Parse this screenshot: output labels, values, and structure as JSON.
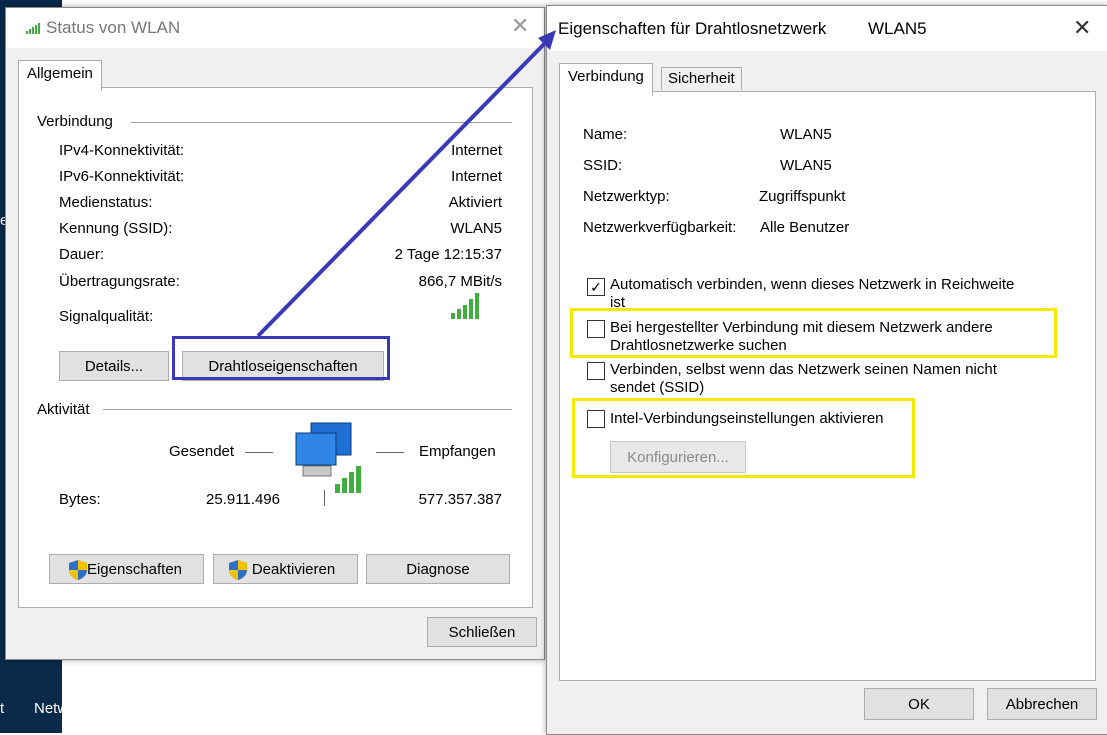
{
  "desktop": {
    "text1": "Netw",
    "text2": "e",
    "text3": "t"
  },
  "status_window": {
    "title": "Status von WLAN",
    "tab": "Allgemein",
    "connection_group": "Verbindung",
    "rows": [
      {
        "label": "IPv4-Konnektivität:",
        "value": "Internet"
      },
      {
        "label": "IPv6-Konnektivität:",
        "value": "Internet"
      },
      {
        "label": "Medienstatus:",
        "value": "Aktiviert"
      },
      {
        "label": "Kennung (SSID):",
        "value": "WLAN5"
      },
      {
        "label": "Dauer:",
        "value": "2 Tage 12:15:37"
      },
      {
        "label": "Übertragungsrate:",
        "value": "866,7 MBit/s"
      }
    ],
    "signal_label": "Signalqualität:",
    "details_button": "Details...",
    "wireless_props_button": "Drahtloseigenschaften",
    "activity_group": "Aktivität",
    "sent_label": "Gesendet",
    "received_label": "Empfangen",
    "bytes_label": "Bytes:",
    "bytes_sent": "25.911.496",
    "bytes_received": "577.357.387",
    "properties_button": "Eigenschaften",
    "deactivate_button": "Deaktivieren",
    "diagnose_button": "Diagnose",
    "close_button": "Schließen"
  },
  "props_window": {
    "title": "Eigenschaften für Drahtlosnetzwerk",
    "title_network": "WLAN5",
    "tab_connection": "Verbindung",
    "tab_security": "Sicherheit",
    "fields": [
      {
        "label": "Name:",
        "value": "WLAN5"
      },
      {
        "label": "SSID:",
        "value": "WLAN5"
      },
      {
        "label": "Netzwerktyp:",
        "value": "Zugriffspunkt"
      },
      {
        "label": "Netzwerkverfügbarkeit:",
        "value": "Alle Benutzer"
      }
    ],
    "options": [
      {
        "line1": "Automatisch verbinden, wenn dieses Netzwerk in Reichweite",
        "line2": "ist",
        "checked": true
      },
      {
        "line1": "Bei hergestellter Verbindung mit diesem Netzwerk andere",
        "line2": "Drahtlosnetzwerke suchen",
        "checked": false
      },
      {
        "line1": "Verbinden, selbst wenn das Netzwerk seinen Namen nicht",
        "line2": "sendet (SSID)",
        "checked": false
      },
      {
        "line1": "Intel-Verbindungseinstellungen aktivieren",
        "line2": "",
        "checked": false
      }
    ],
    "checkmark": "✓",
    "configure_button": "Konfigurieren...",
    "ok_button": "OK",
    "cancel_button": "Abbrechen"
  },
  "colors": {
    "highlight_yellow": "#f5e900",
    "highlight_blue": "#3a3ab8",
    "signal_green": "#3fae3f"
  }
}
